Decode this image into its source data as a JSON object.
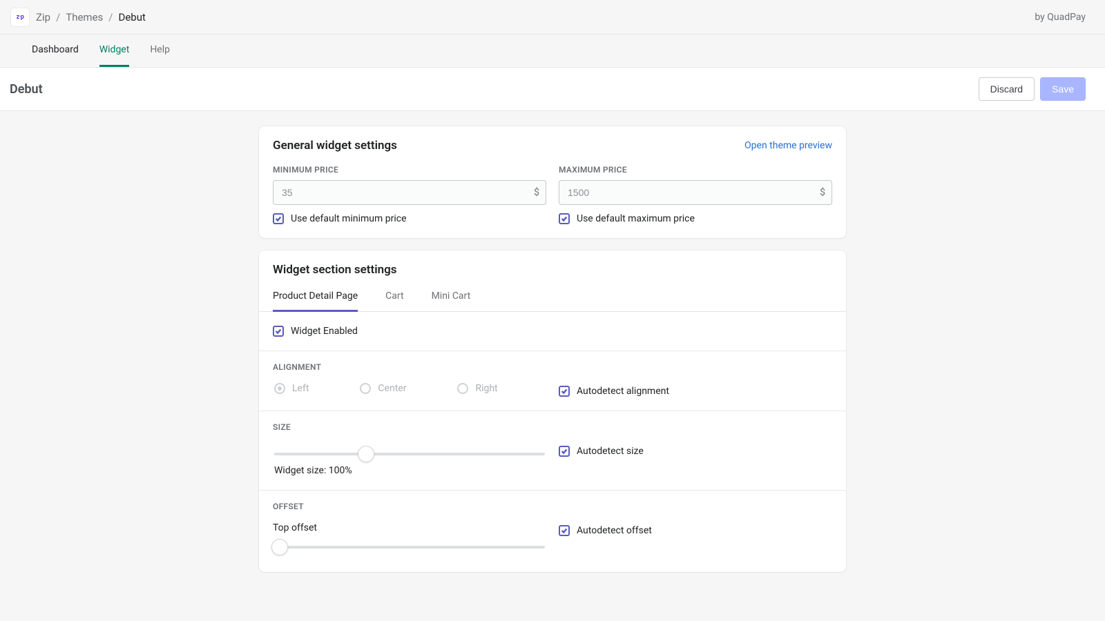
{
  "breadcrumb": {
    "app": "Zip",
    "mid": "Themes",
    "current": "Debut"
  },
  "byline": "by QuadPay",
  "nav": {
    "dashboard": "Dashboard",
    "widget": "Widget",
    "help": "Help"
  },
  "page": {
    "title": "Debut"
  },
  "actions": {
    "discard": "Discard",
    "save": "Save"
  },
  "general": {
    "title": "General widget settings",
    "preview_link": "Open theme preview",
    "min": {
      "label": "MINIMUM PRICE",
      "value": "35",
      "suffix": "$",
      "default_cb": "Use default minimum price"
    },
    "max": {
      "label": "MAXIMUM PRICE",
      "value": "1500",
      "suffix": "$",
      "default_cb": "Use default maximum price"
    }
  },
  "sections": {
    "title": "Widget section settings",
    "tabs": {
      "pdp": "Product Detail Page",
      "cart": "Cart",
      "mini": "Mini Cart"
    },
    "enabled_cb": "Widget Enabled",
    "alignment": {
      "label": "ALIGNMENT",
      "left": "Left",
      "center": "Center",
      "right": "Right",
      "auto_cb": "Autodetect alignment"
    },
    "size": {
      "label": "SIZE",
      "caption": "Widget size: 100%",
      "auto_cb": "Autodetect size",
      "percent": 34
    },
    "offset": {
      "label": "OFFSET",
      "top_label": "Top offset",
      "auto_cb": "Autodetect offset"
    }
  }
}
